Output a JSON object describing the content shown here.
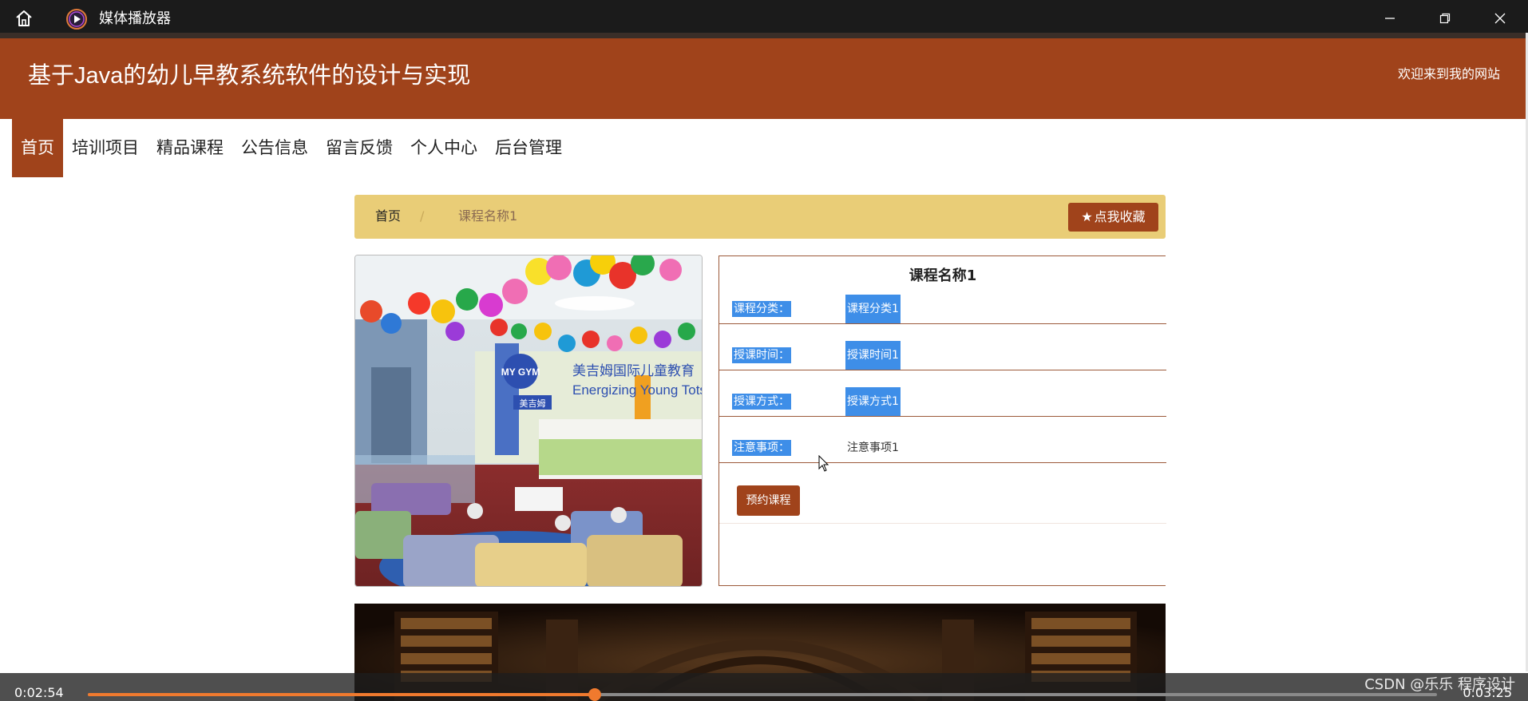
{
  "player": {
    "title": "媒体播放器",
    "current_time": "0:02:54",
    "total_time": "0:03:25",
    "progress": 0.376,
    "accent_color": "#f07a2e",
    "icons": [
      "home-icon",
      "media-player-icon",
      "minimize-icon",
      "restore-icon",
      "close-icon"
    ]
  },
  "site": {
    "title": "基于Java的幼儿早教系统软件的设计与实现",
    "welcome": "欢迎来到我的网站",
    "brand_color": "#a0431b",
    "nav": [
      {
        "label": "首页",
        "active": true
      },
      {
        "label": "培训项目",
        "active": false
      },
      {
        "label": "精品课程",
        "active": false
      },
      {
        "label": "公告信息",
        "active": false
      },
      {
        "label": "留言反馈",
        "active": false
      },
      {
        "label": "个人中心",
        "active": false
      },
      {
        "label": "后台管理",
        "active": false
      }
    ]
  },
  "breadcrumb": {
    "home": "首页",
    "separator": "/",
    "current": "课程名称1",
    "favorite_label": "点我收藏"
  },
  "course": {
    "title": "课程名称1",
    "rows": [
      {
        "label": "课程分类：",
        "value": "课程分类1"
      },
      {
        "label": "授课时间：",
        "value": "授课时间1"
      },
      {
        "label": "授课方式：",
        "value": "授课方式1"
      },
      {
        "label": "注意事项：",
        "value": "注意事项1"
      }
    ],
    "book_label": "预约课程",
    "image_text": {
      "brand": "MY GYM",
      "chinese": "美吉姆国际儿童教育",
      "english": "Energizing Young Tots",
      "desk_sign": "美吉姆"
    }
  },
  "watermark": "CSDN @乐乐 程序设计"
}
